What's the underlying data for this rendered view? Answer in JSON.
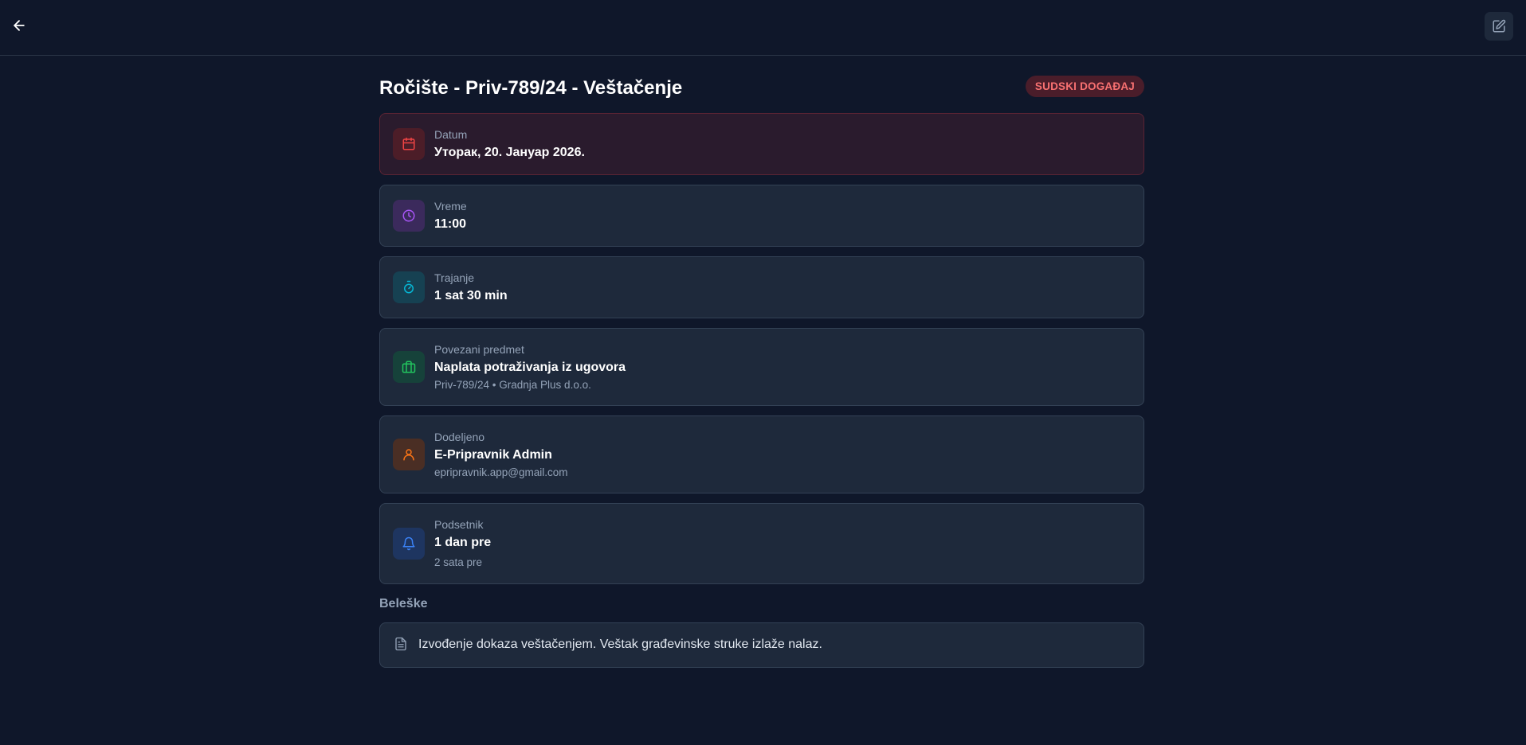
{
  "header": {
    "back_icon": "arrow-left-icon",
    "edit_icon": "edit-icon"
  },
  "event": {
    "title": "Ročište - Priv-789/24 - Veštačenje",
    "badge": "SUDSKI DOGAĐAJ"
  },
  "details": {
    "date": {
      "label": "Datum",
      "value": "Уторак, 20. Јануар 2026.",
      "icon": "calendar-icon",
      "color": "#ef4444"
    },
    "time": {
      "label": "Vreme",
      "value": "11:00",
      "icon": "clock-icon",
      "color": "#a855f7"
    },
    "duration": {
      "label": "Trajanje",
      "value": "1 sat 30 min",
      "icon": "timer-icon",
      "color": "#06b6d4"
    },
    "case": {
      "label": "Povezani predmet",
      "value": "Naplata potraživanja iz ugovora",
      "sub": "Priv-789/24 • Gradnja Plus d.o.o.",
      "icon": "briefcase-icon",
      "color": "#22c55e"
    },
    "assigned": {
      "label": "Dodeljeno",
      "value": "E-Pripravnik Admin",
      "sub": "epripravnik.app@gmail.com",
      "icon": "user-icon",
      "color": "#f97316"
    },
    "reminder": {
      "label": "Podsetnik",
      "value": "1 dan pre",
      "sub": "2 sata pre",
      "icon": "bell-icon",
      "color": "#3b82f6"
    }
  },
  "notes": {
    "title": "Beleške",
    "text": "Izvođenje dokaza veštačenjem. Veštak građevinske struke izlaže nalaz.",
    "icon": "document-icon"
  }
}
